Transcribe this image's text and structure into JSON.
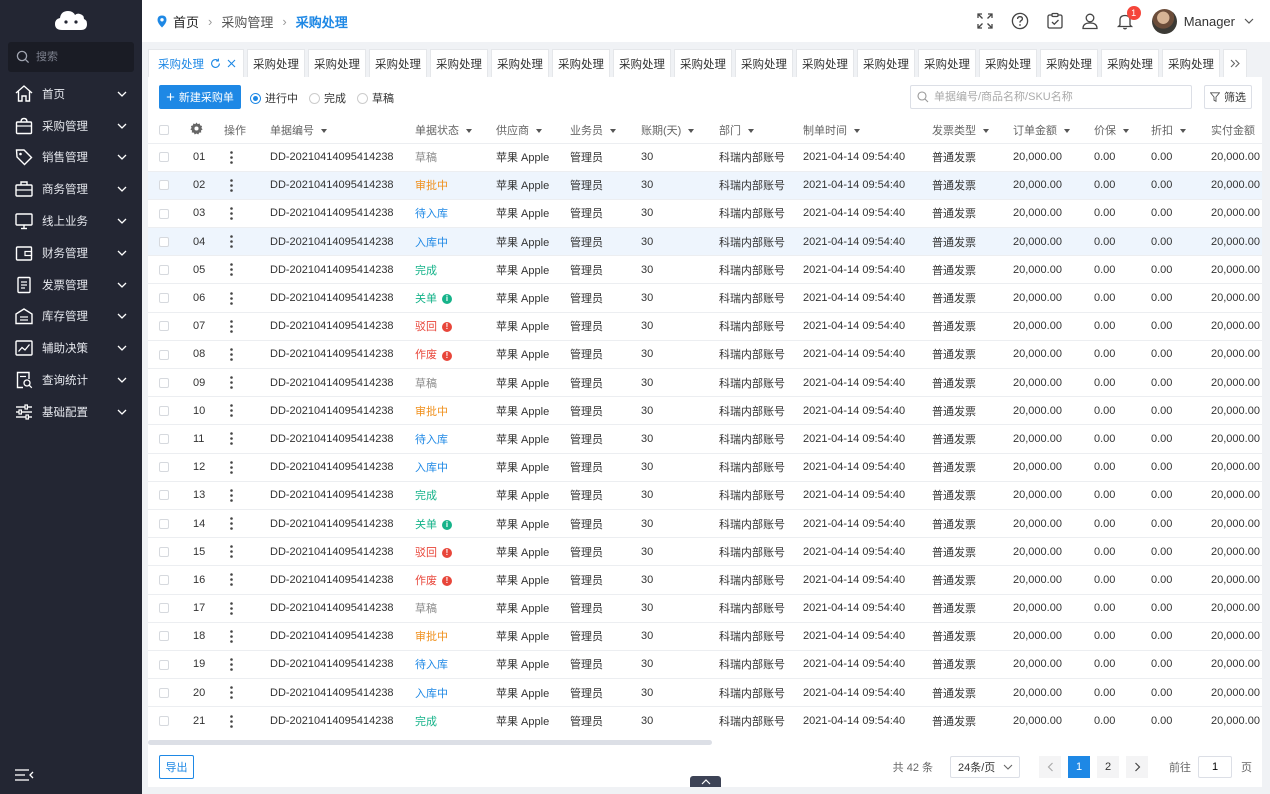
{
  "sidebar": {
    "search_placeholder": "搜索",
    "items": [
      {
        "label": "首页",
        "icon": "home-icon"
      },
      {
        "label": "采购管理",
        "icon": "bag-icon"
      },
      {
        "label": "销售管理",
        "icon": "tag-icon"
      },
      {
        "label": "商务管理",
        "icon": "briefcase-icon"
      },
      {
        "label": "线上业务",
        "icon": "monitor-icon"
      },
      {
        "label": "财务管理",
        "icon": "wallet-icon"
      },
      {
        "label": "发票管理",
        "icon": "invoice-icon"
      },
      {
        "label": "库存管理",
        "icon": "warehouse-icon"
      },
      {
        "label": "辅助决策",
        "icon": "trend-chart-icon"
      },
      {
        "label": "查询统计",
        "icon": "report-search-icon"
      },
      {
        "label": "基础配置",
        "icon": "sliders-icon"
      }
    ]
  },
  "header": {
    "breadcrumb": [
      "首页",
      "采购管理",
      "采购处理"
    ],
    "notification_count": "1",
    "user_name": "Manager"
  },
  "tabs": {
    "active": "采购处理",
    "items": [
      "采购处理",
      "采购处理",
      "采购处理",
      "采购处理",
      "采购处理",
      "采购处理",
      "采购处理",
      "采购处理",
      "采购处理",
      "采购处理",
      "采购处理",
      "采购处理",
      "采购处理",
      "采购处理",
      "采购处理",
      "采购处理"
    ]
  },
  "toolbar": {
    "new_button": "新建采购单",
    "radios": [
      {
        "label": "进行中",
        "checked": true
      },
      {
        "label": "完成",
        "checked": false
      },
      {
        "label": "草稿",
        "checked": false
      }
    ],
    "search_placeholder": "单据编号/商品名称/SKU名称",
    "filter_button": "筛选"
  },
  "table": {
    "columns": [
      "操作",
      "单据编号",
      "单据状态",
      "供应商",
      "业务员",
      "账期(天)",
      "部门",
      "制单时间",
      "发票类型",
      "订单金额",
      "价保",
      "折扣",
      "实付金额"
    ],
    "status_colors": {
      "草稿": "#8c8c8c",
      "审批中": "#f0901c",
      "待入库": "#1e88e5",
      "入库中": "#1e88e5",
      "完成": "#16b38a",
      "关单": "#16b38a",
      "驳回": "#e8463a",
      "作废": "#e8463a"
    },
    "rows": [
      {
        "idx": "01",
        "no": "DD-20210414095414238",
        "status": "草稿",
        "supplier": "苹果 Apple",
        "clerk": "管理员",
        "term": "30",
        "dept": "科瑞内部账号",
        "time": "2021-04-14 09:54:40",
        "invoice": "普通发票",
        "amount": "20,000.00",
        "price_protect": "0.00",
        "discount": "0.00",
        "paid": "20,000.00"
      },
      {
        "idx": "02",
        "no": "DD-20210414095414238",
        "status": "审批中",
        "supplier": "苹果 Apple",
        "clerk": "管理员",
        "term": "30",
        "dept": "科瑞内部账号",
        "time": "2021-04-14 09:54:40",
        "invoice": "普通发票",
        "amount": "20,000.00",
        "price_protect": "0.00",
        "discount": "0.00",
        "paid": "20,000.00"
      },
      {
        "idx": "03",
        "no": "DD-20210414095414238",
        "status": "待入库",
        "supplier": "苹果 Apple",
        "clerk": "管理员",
        "term": "30",
        "dept": "科瑞内部账号",
        "time": "2021-04-14 09:54:40",
        "invoice": "普通发票",
        "amount": "20,000.00",
        "price_protect": "0.00",
        "discount": "0.00",
        "paid": "20,000.00"
      },
      {
        "idx": "04",
        "no": "DD-20210414095414238",
        "status": "入库中",
        "supplier": "苹果 Apple",
        "clerk": "管理员",
        "term": "30",
        "dept": "科瑞内部账号",
        "time": "2021-04-14 09:54:40",
        "invoice": "普通发票",
        "amount": "20,000.00",
        "price_protect": "0.00",
        "discount": "0.00",
        "paid": "20,000.00"
      },
      {
        "idx": "05",
        "no": "DD-20210414095414238",
        "status": "完成",
        "supplier": "苹果 Apple",
        "clerk": "管理员",
        "term": "30",
        "dept": "科瑞内部账号",
        "time": "2021-04-14 09:54:40",
        "invoice": "普通发票",
        "amount": "20,000.00",
        "price_protect": "0.00",
        "discount": "0.00",
        "paid": "20,000.00"
      },
      {
        "idx": "06",
        "no": "DD-20210414095414238",
        "status": "关单",
        "supplier": "苹果 Apple",
        "clerk": "管理员",
        "term": "30",
        "dept": "科瑞内部账号",
        "time": "2021-04-14 09:54:40",
        "invoice": "普通发票",
        "amount": "20,000.00",
        "price_protect": "0.00",
        "discount": "0.00",
        "paid": "20,000.00"
      },
      {
        "idx": "07",
        "no": "DD-20210414095414238",
        "status": "驳回",
        "supplier": "苹果 Apple",
        "clerk": "管理员",
        "term": "30",
        "dept": "科瑞内部账号",
        "time": "2021-04-14 09:54:40",
        "invoice": "普通发票",
        "amount": "20,000.00",
        "price_protect": "0.00",
        "discount": "0.00",
        "paid": "20,000.00"
      },
      {
        "idx": "08",
        "no": "DD-20210414095414238",
        "status": "作废",
        "supplier": "苹果 Apple",
        "clerk": "管理员",
        "term": "30",
        "dept": "科瑞内部账号",
        "time": "2021-04-14 09:54:40",
        "invoice": "普通发票",
        "amount": "20,000.00",
        "price_protect": "0.00",
        "discount": "0.00",
        "paid": "20,000.00"
      },
      {
        "idx": "09",
        "no": "DD-20210414095414238",
        "status": "草稿",
        "supplier": "苹果 Apple",
        "clerk": "管理员",
        "term": "30",
        "dept": "科瑞内部账号",
        "time": "2021-04-14 09:54:40",
        "invoice": "普通发票",
        "amount": "20,000.00",
        "price_protect": "0.00",
        "discount": "0.00",
        "paid": "20,000.00"
      },
      {
        "idx": "10",
        "no": "DD-20210414095414238",
        "status": "审批中",
        "supplier": "苹果 Apple",
        "clerk": "管理员",
        "term": "30",
        "dept": "科瑞内部账号",
        "time": "2021-04-14 09:54:40",
        "invoice": "普通发票",
        "amount": "20,000.00",
        "price_protect": "0.00",
        "discount": "0.00",
        "paid": "20,000.00"
      },
      {
        "idx": "11",
        "no": "DD-20210414095414238",
        "status": "待入库",
        "supplier": "苹果 Apple",
        "clerk": "管理员",
        "term": "30",
        "dept": "科瑞内部账号",
        "time": "2021-04-14 09:54:40",
        "invoice": "普通发票",
        "amount": "20,000.00",
        "price_protect": "0.00",
        "discount": "0.00",
        "paid": "20,000.00"
      },
      {
        "idx": "12",
        "no": "DD-20210414095414238",
        "status": "入库中",
        "supplier": "苹果 Apple",
        "clerk": "管理员",
        "term": "30",
        "dept": "科瑞内部账号",
        "time": "2021-04-14 09:54:40",
        "invoice": "普通发票",
        "amount": "20,000.00",
        "price_protect": "0.00",
        "discount": "0.00",
        "paid": "20,000.00"
      },
      {
        "idx": "13",
        "no": "DD-20210414095414238",
        "status": "完成",
        "supplier": "苹果 Apple",
        "clerk": "管理员",
        "term": "30",
        "dept": "科瑞内部账号",
        "time": "2021-04-14 09:54:40",
        "invoice": "普通发票",
        "amount": "20,000.00",
        "price_protect": "0.00",
        "discount": "0.00",
        "paid": "20,000.00"
      },
      {
        "idx": "14",
        "no": "DD-20210414095414238",
        "status": "关单",
        "supplier": "苹果 Apple",
        "clerk": "管理员",
        "term": "30",
        "dept": "科瑞内部账号",
        "time": "2021-04-14 09:54:40",
        "invoice": "普通发票",
        "amount": "20,000.00",
        "price_protect": "0.00",
        "discount": "0.00",
        "paid": "20,000.00"
      },
      {
        "idx": "15",
        "no": "DD-20210414095414238",
        "status": "驳回",
        "supplier": "苹果 Apple",
        "clerk": "管理员",
        "term": "30",
        "dept": "科瑞内部账号",
        "time": "2021-04-14 09:54:40",
        "invoice": "普通发票",
        "amount": "20,000.00",
        "price_protect": "0.00",
        "discount": "0.00",
        "paid": "20,000.00"
      },
      {
        "idx": "16",
        "no": "DD-20210414095414238",
        "status": "作废",
        "supplier": "苹果 Apple",
        "clerk": "管理员",
        "term": "30",
        "dept": "科瑞内部账号",
        "time": "2021-04-14 09:54:40",
        "invoice": "普通发票",
        "amount": "20,000.00",
        "price_protect": "0.00",
        "discount": "0.00",
        "paid": "20,000.00"
      },
      {
        "idx": "17",
        "no": "DD-20210414095414238",
        "status": "草稿",
        "supplier": "苹果 Apple",
        "clerk": "管理员",
        "term": "30",
        "dept": "科瑞内部账号",
        "time": "2021-04-14 09:54:40",
        "invoice": "普通发票",
        "amount": "20,000.00",
        "price_protect": "0.00",
        "discount": "0.00",
        "paid": "20,000.00"
      },
      {
        "idx": "18",
        "no": "DD-20210414095414238",
        "status": "审批中",
        "supplier": "苹果 Apple",
        "clerk": "管理员",
        "term": "30",
        "dept": "科瑞内部账号",
        "time": "2021-04-14 09:54:40",
        "invoice": "普通发票",
        "amount": "20,000.00",
        "price_protect": "0.00",
        "discount": "0.00",
        "paid": "20,000.00"
      },
      {
        "idx": "19",
        "no": "DD-20210414095414238",
        "status": "待入库",
        "supplier": "苹果 Apple",
        "clerk": "管理员",
        "term": "30",
        "dept": "科瑞内部账号",
        "time": "2021-04-14 09:54:40",
        "invoice": "普通发票",
        "amount": "20,000.00",
        "price_protect": "0.00",
        "discount": "0.00",
        "paid": "20,000.00"
      },
      {
        "idx": "20",
        "no": "DD-20210414095414238",
        "status": "入库中",
        "supplier": "苹果 Apple",
        "clerk": "管理员",
        "term": "30",
        "dept": "科瑞内部账号",
        "time": "2021-04-14 09:54:40",
        "invoice": "普通发票",
        "amount": "20,000.00",
        "price_protect": "0.00",
        "discount": "0.00",
        "paid": "20,000.00"
      },
      {
        "idx": "21",
        "no": "DD-20210414095414238",
        "status": "完成",
        "supplier": "苹果 Apple",
        "clerk": "管理员",
        "term": "30",
        "dept": "科瑞内部账号",
        "time": "2021-04-14 09:54:40",
        "invoice": "普通发票",
        "amount": "20,000.00",
        "price_protect": "0.00",
        "discount": "0.00",
        "paid": "20,000.00"
      }
    ]
  },
  "footer": {
    "export_button": "导出",
    "total": "共 42 条",
    "page_size": "24条/页",
    "pages": [
      "1",
      "2"
    ],
    "current_page": "1",
    "goto_label": "前往",
    "goto_value": "1",
    "goto_suffix": "页"
  },
  "colors": {
    "accent": "#1e88e5",
    "sidebar_bg": "#232633",
    "highlight_row": "#eef5fd"
  }
}
